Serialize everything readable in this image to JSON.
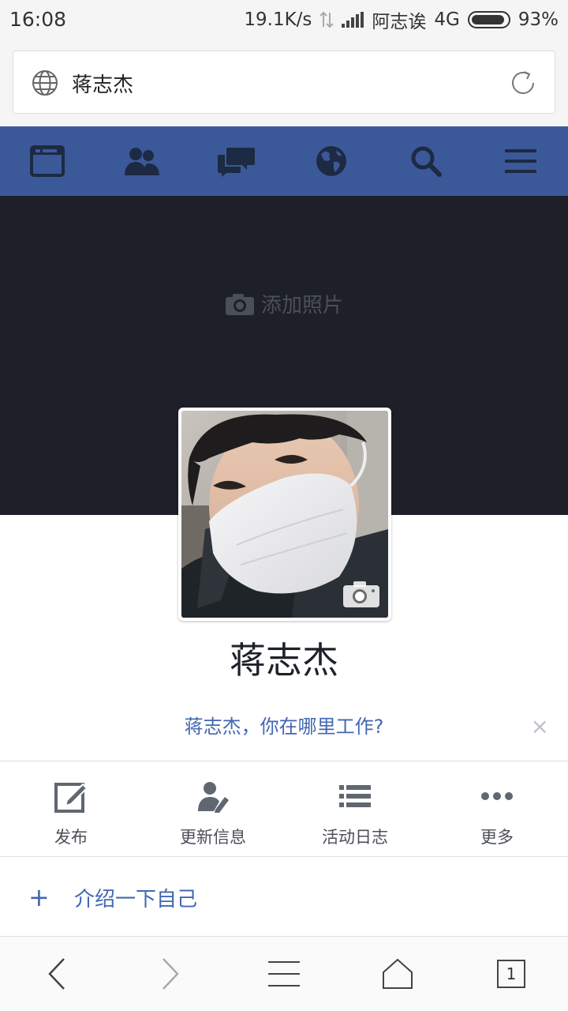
{
  "status_bar": {
    "time": "16:08",
    "speed": "19.1K/s",
    "carrier": "阿志诶",
    "network": "4G",
    "battery": "93%",
    "battery_level": 0.93
  },
  "address_bar": {
    "text": "蒋志杰",
    "icons": [
      "globe-icon",
      "reload-icon"
    ]
  },
  "fb_nav": {
    "items": [
      "news-feed-icon",
      "friends-icon",
      "messages-icon",
      "notifications-globe-icon",
      "search-icon",
      "menu-icon"
    ],
    "color": "#3b5998"
  },
  "cover": {
    "add_photo_label": "添加照片",
    "background": "#1d2029"
  },
  "profile": {
    "name": "蒋志杰",
    "work_prompt": "蒋志杰，你在哪里工作?",
    "dismiss": "×"
  },
  "actions": [
    {
      "label": "发布",
      "icon": "edit-icon"
    },
    {
      "label": "更新信息",
      "icon": "edit-profile-icon"
    },
    {
      "label": "活动日志",
      "icon": "activity-log-icon"
    },
    {
      "label": "更多",
      "icon": "more-icon"
    }
  ],
  "intro": {
    "plus": "+",
    "label": "介绍一下自己"
  },
  "browser_bar": {
    "tab_count": "1",
    "icons": [
      "back-icon",
      "forward-icon",
      "menu-icon",
      "home-icon",
      "tabs-icon"
    ]
  }
}
